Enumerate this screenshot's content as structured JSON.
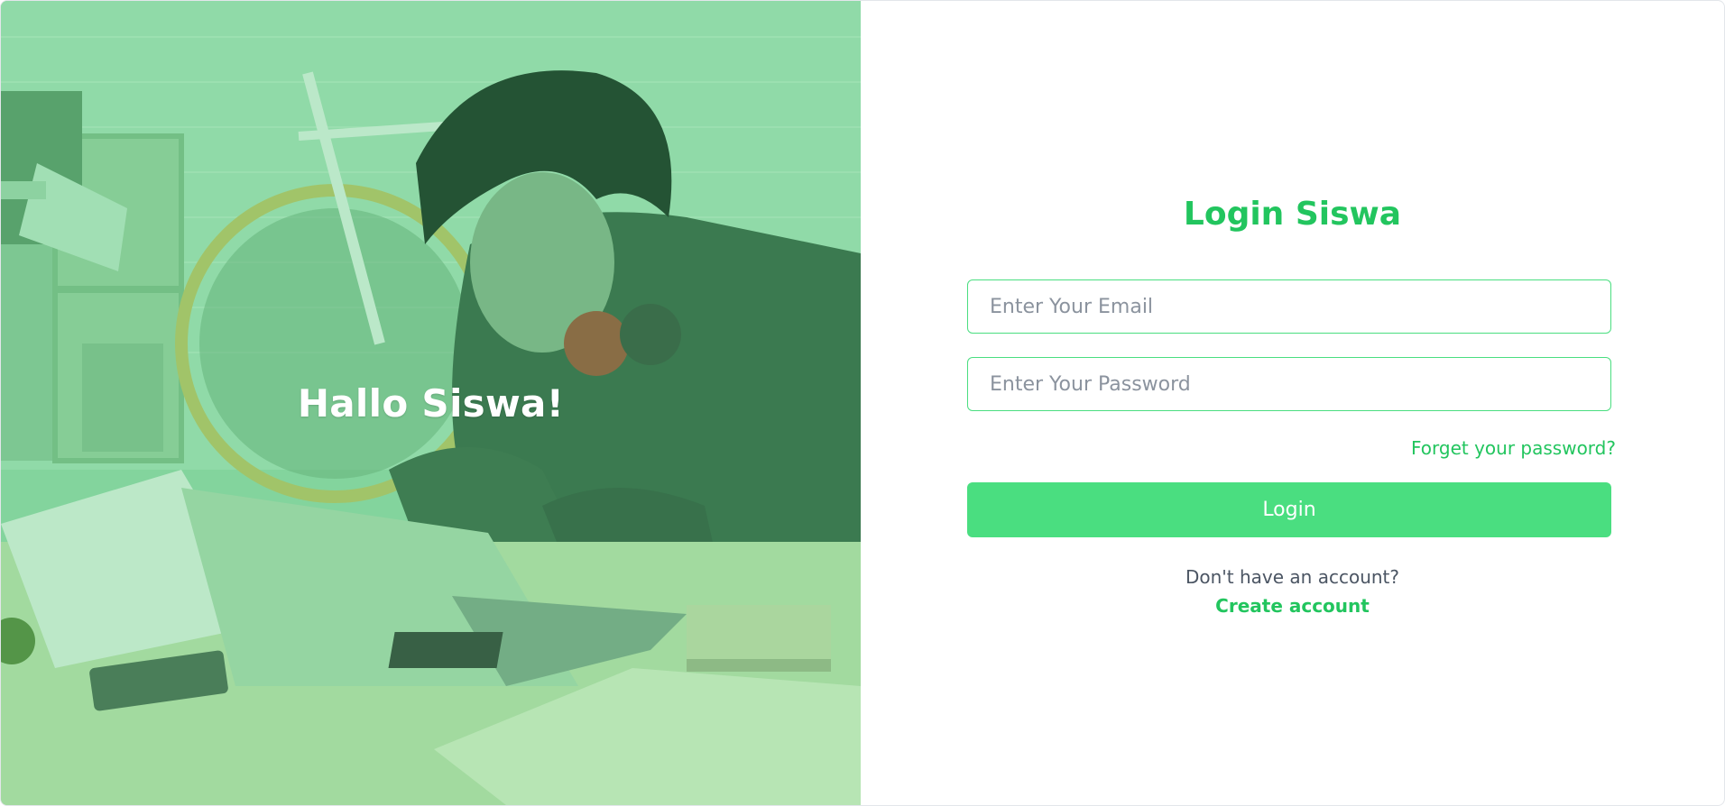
{
  "hero": {
    "greeting": "Hallo Siswa!",
    "image": "student-studying-with-laptop-photo",
    "tint_color": "#93d7a8"
  },
  "login": {
    "title": "Login Siswa",
    "email_placeholder": "Enter Your Email",
    "email_value": "",
    "password_placeholder": "Enter Your Password",
    "password_value": "",
    "forgot_label": "Forget your password?",
    "login_label": "Login",
    "no_account_text": "Don't have an account?",
    "create_account_label": "Create account"
  },
  "colors": {
    "accent": "#22c55e",
    "button": "#4ade80",
    "input_border": "#4ade80"
  }
}
